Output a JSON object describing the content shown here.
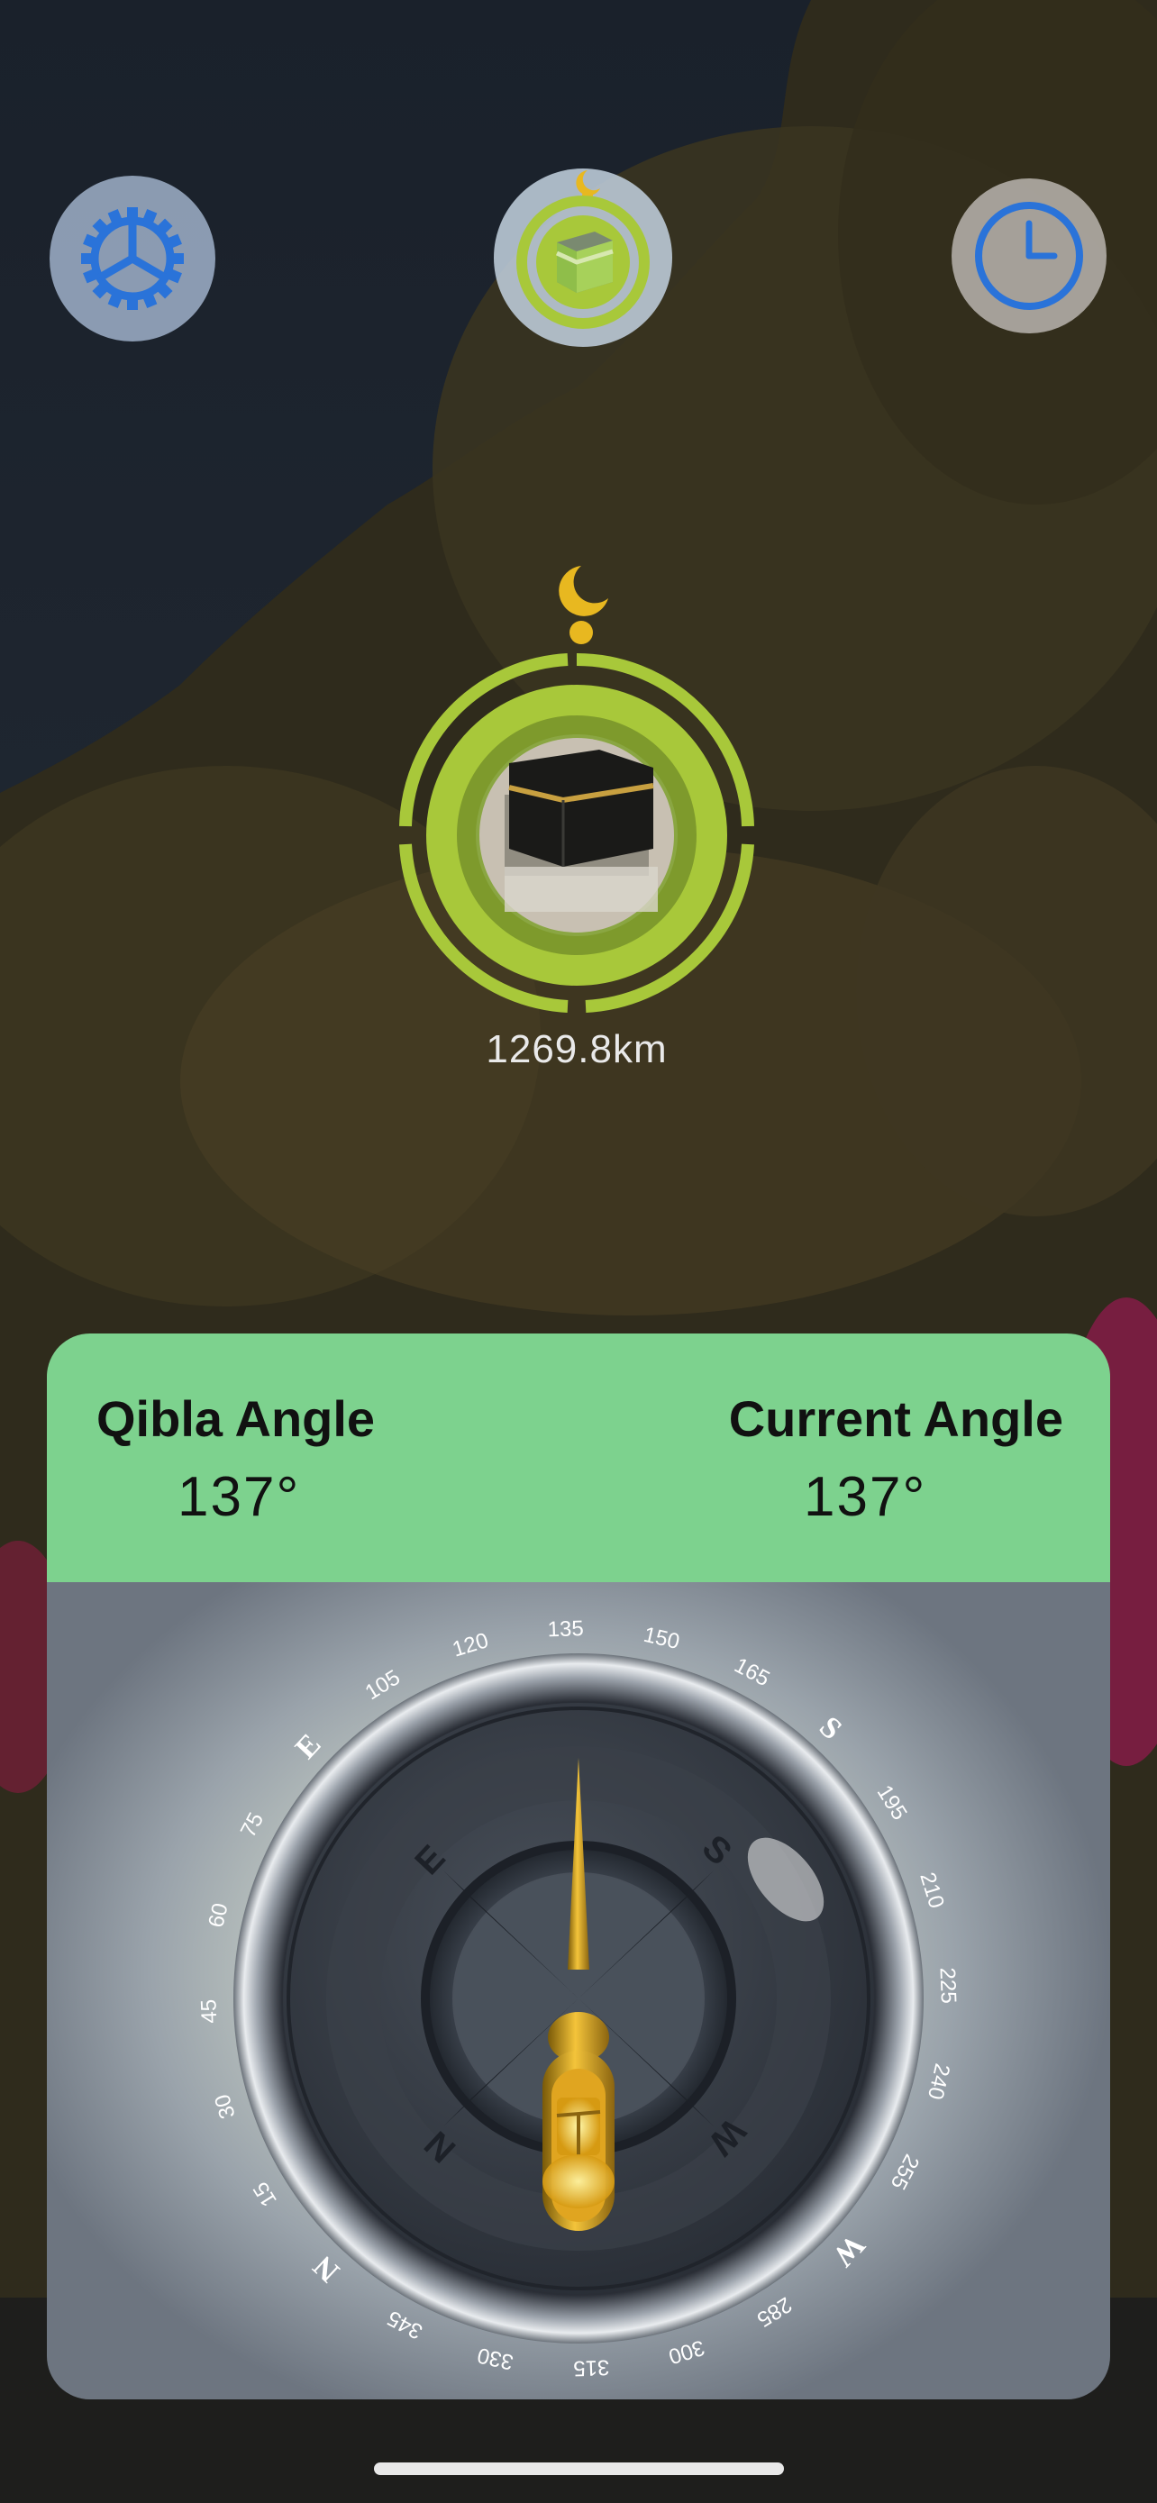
{
  "toolbar": {
    "settings_icon": "gear-icon",
    "qibla_icon": "kaaba-crescent-icon",
    "clock_icon": "clock-icon"
  },
  "qibla": {
    "distance": "1269.8km"
  },
  "angles": {
    "qibla_label": "Qibla Angle",
    "qibla_value": "137°",
    "current_label": "Current Angle",
    "current_value": "137°"
  },
  "compass": {
    "outer_ticks": [
      "N",
      "15",
      "30",
      "45",
      "60",
      "75",
      "E",
      "105",
      "120",
      "135",
      "150",
      "165",
      "S",
      "195",
      "210",
      "225",
      "240",
      "255",
      "W",
      "285",
      "300",
      "315",
      "330",
      "345"
    ],
    "inner_cardinals": [
      "N",
      "E",
      "S",
      "W"
    ],
    "heading_degrees": 137
  },
  "colors": {
    "header_green": "#7dd28e",
    "icon_blue": "#2a73d9",
    "badge_green": "#a8c83a",
    "crescent_gold": "#e8b820"
  }
}
